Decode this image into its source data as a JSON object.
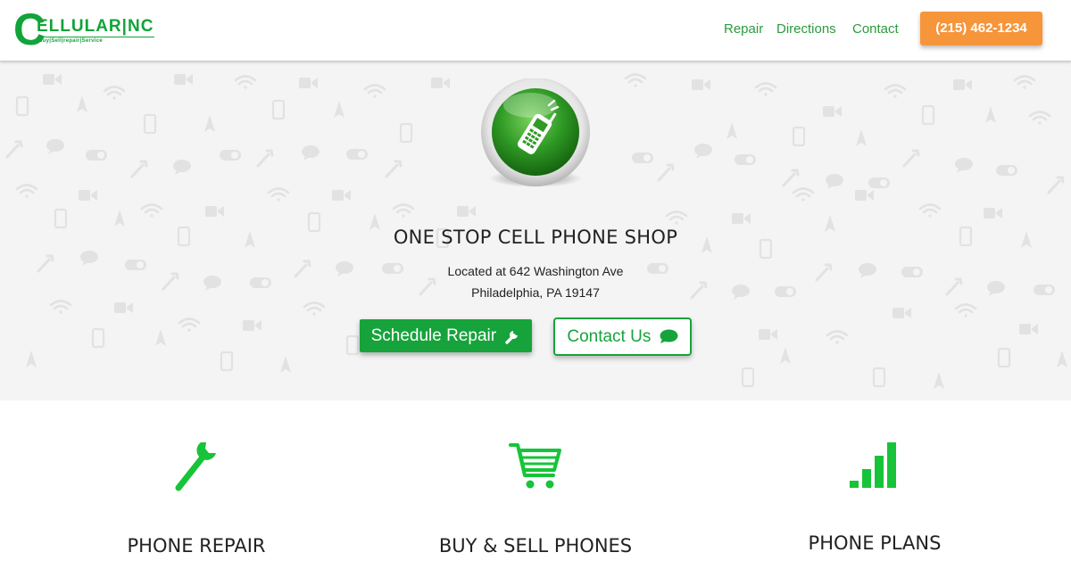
{
  "brand": {
    "big_letter": "C",
    "word": "ELLULAR|NC",
    "tagline": "Buy|Sell|repair|Service",
    "color": "#12a33a"
  },
  "nav": {
    "items": [
      "Repair",
      "Directions",
      "Contact"
    ],
    "phone": "(215) 462-1234",
    "link_color": "#2a9b3d",
    "phone_color": "#f6953a"
  },
  "hero": {
    "icon": "cell-phone-orb-icon",
    "title": "ONE STOP CELL PHONE SHOP",
    "address_line1": "Located at 642 Washington Ave",
    "address_line2": "Philadelphia, PA 19147",
    "schedule_button": "Schedule Repair",
    "schedule_icon": "wrench-icon",
    "contact_button": "Contact Us",
    "contact_icon": "comment-icon",
    "accent": "#17a33b"
  },
  "features": [
    {
      "title": "PHONE REPAIR",
      "icon": "wrench-icon"
    },
    {
      "title": "BUY & SELL PHONES",
      "icon": "shopping-cart-icon"
    },
    {
      "title": "PHONE PLANS",
      "icon": "signal-bars-icon"
    }
  ]
}
